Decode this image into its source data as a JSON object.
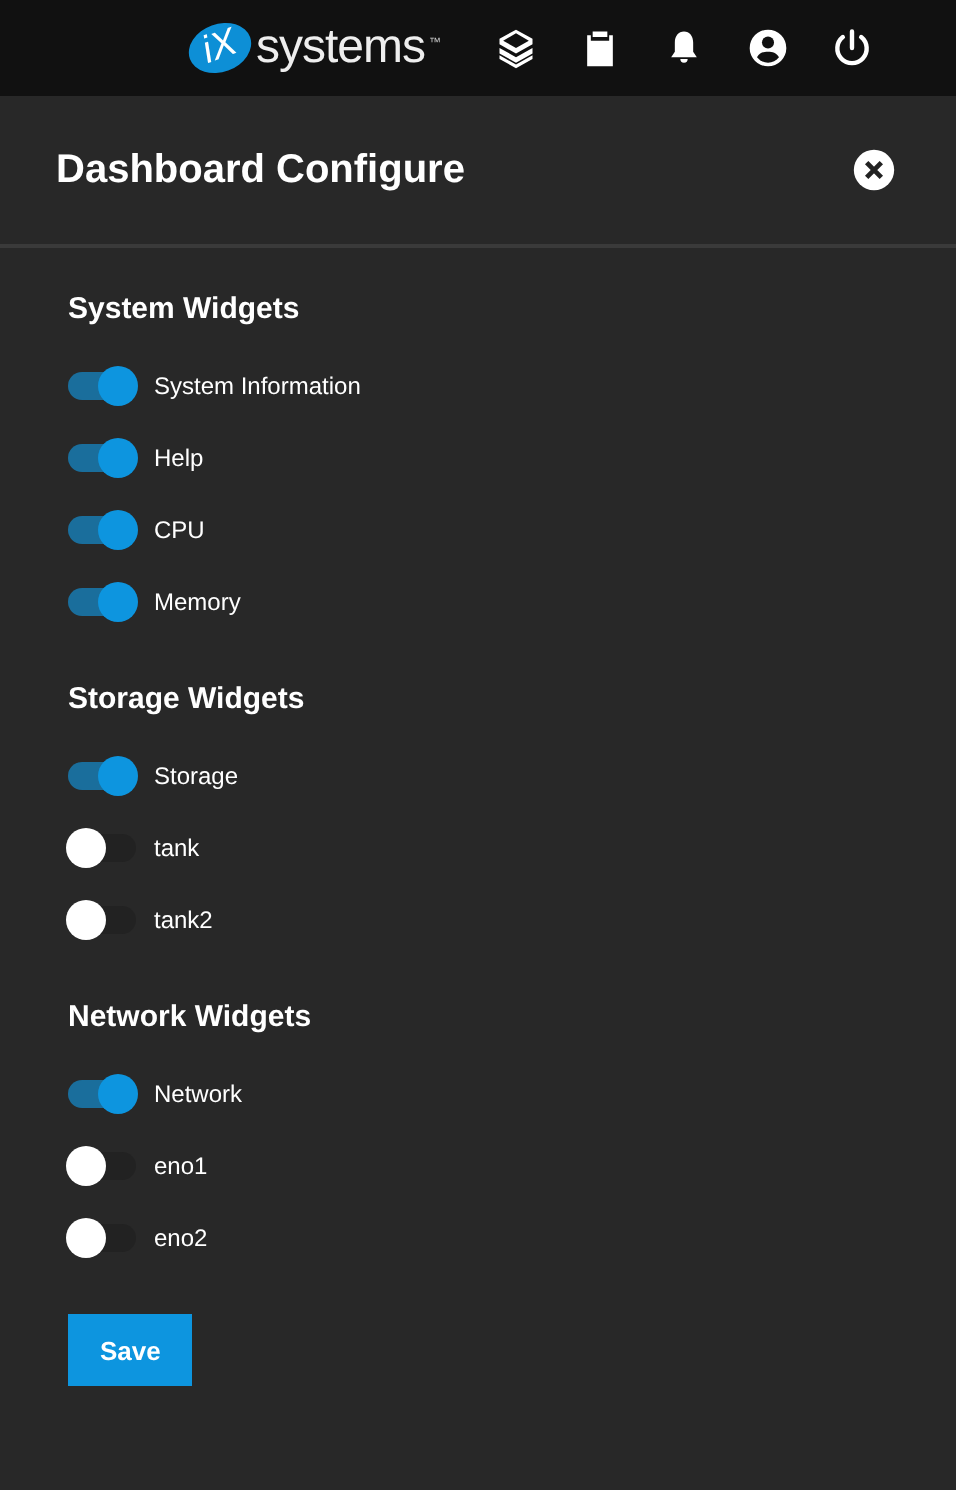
{
  "topbar": {
    "logo": {
      "mark": "iX",
      "word": "systems",
      "tm": "™"
    }
  },
  "panel": {
    "title": "Dashboard Configure",
    "sections": [
      {
        "heading": "System Widgets",
        "widgets": [
          {
            "label": "System Information",
            "on": true
          },
          {
            "label": "Help",
            "on": true
          },
          {
            "label": "CPU",
            "on": true
          },
          {
            "label": "Memory",
            "on": true
          }
        ]
      },
      {
        "heading": "Storage Widgets",
        "widgets": [
          {
            "label": "Storage",
            "on": true
          },
          {
            "label": "tank",
            "on": false
          },
          {
            "label": "tank2",
            "on": false
          }
        ]
      },
      {
        "heading": "Network Widgets",
        "widgets": [
          {
            "label": "Network",
            "on": true
          },
          {
            "label": "eno1",
            "on": false
          },
          {
            "label": "eno2",
            "on": false
          }
        ]
      }
    ],
    "save_button": "Save"
  }
}
